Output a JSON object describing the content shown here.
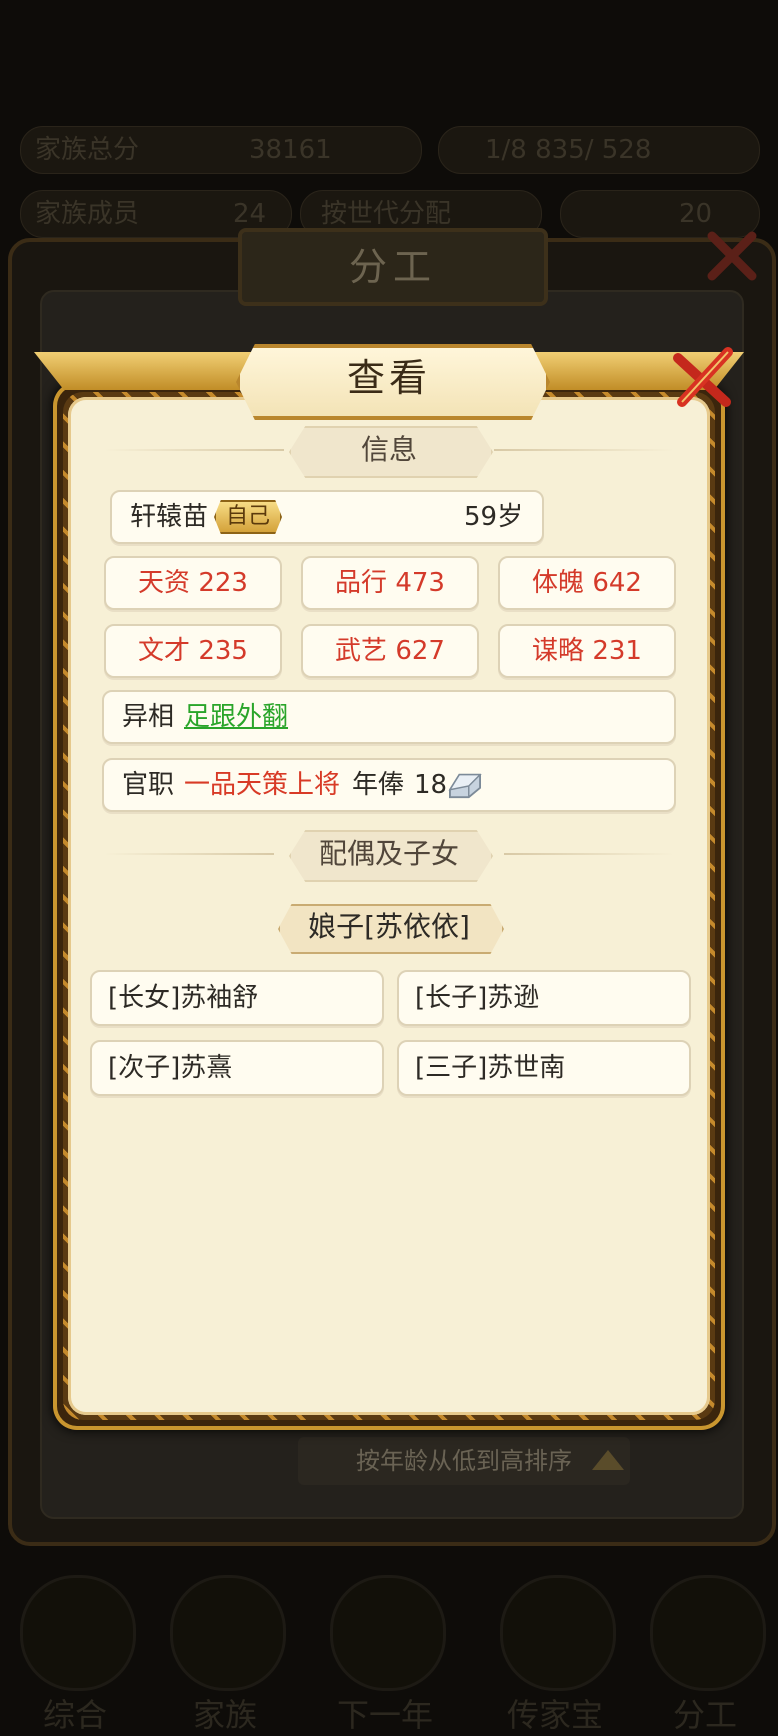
{
  "background": {
    "stats_left_1": "家族总分",
    "stats_val_1": "38161",
    "stats_right_1": "1∕8 835/ 528",
    "stats_left_2": "家族成员",
    "stats_val_2": "24",
    "stats_mid_2": "按世代分配",
    "stats_right_2": "20",
    "panel_title": "分工",
    "sort_label": "按年龄从低到高排序",
    "nav": [
      "综合",
      "家族",
      "下一年",
      "传家宝",
      "分工"
    ]
  },
  "dialog": {
    "title": "查看",
    "info_header": "信息",
    "person": {
      "name": "轩辕苗",
      "self_tag": "自己",
      "age": "59岁"
    },
    "stats": [
      {
        "label": "天资",
        "value": "223"
      },
      {
        "label": "品行",
        "value": "473"
      },
      {
        "label": "体魄",
        "value": "642"
      },
      {
        "label": "文才",
        "value": "235"
      },
      {
        "label": "武艺",
        "value": "627"
      },
      {
        "label": "谋略",
        "value": "231"
      }
    ],
    "trait_label": "异相",
    "trait_value": "足跟外翻",
    "office_label": "官职",
    "office_value": "一品天策上将",
    "salary_label": "年俸",
    "salary_value": "18",
    "family_header": "配偶及子女",
    "spouse": "娘子[苏依依]",
    "children": [
      "[长女]苏袖舒",
      "[长子]苏逊",
      "[次子]苏熹",
      "[三子]苏世南"
    ]
  },
  "colors": {
    "stat_red": "#d43a2a",
    "trait_green": "#2aa52a",
    "paper": "#f7f0d6",
    "frame_gold": "#c9962f"
  }
}
